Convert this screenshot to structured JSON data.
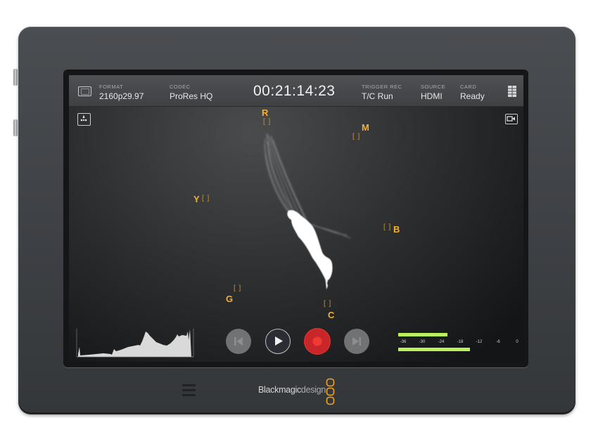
{
  "device": {
    "brand": "Blackmagic",
    "brand_suffix": "design",
    "accent_color": "#f2b134"
  },
  "status_bar": {
    "format": {
      "label": "FORMAT",
      "value": "2160p29.97"
    },
    "codec": {
      "label": "CODEC",
      "value": "ProRes HQ"
    },
    "timecode": "00:21:14:23",
    "trigger_rec": {
      "label": "TRIGGER REC",
      "value": "T/C Run"
    },
    "source": {
      "label": "SOURCE",
      "value": "HDMI"
    },
    "card": {
      "label": "CARD",
      "value": "Ready"
    }
  },
  "icons": {
    "display_mode": "display-icon",
    "settings_menu": "menu-grid-icon",
    "scope_toggle": "vectorscope-icon",
    "camera": "camera-icon"
  },
  "vectorscope": {
    "targets": [
      {
        "label": "R",
        "bracket": "[ ]"
      },
      {
        "label": "M",
        "bracket": "[ ]"
      },
      {
        "label": "Y",
        "bracket": "[ ]"
      },
      {
        "label": "B",
        "bracket": "[ ]"
      },
      {
        "label": "G",
        "bracket": "[ ]"
      },
      {
        "label": "C",
        "bracket": "[ ]"
      }
    ]
  },
  "transport": {
    "prev": "skip-back",
    "play": "play",
    "record": "record",
    "next": "skip-forward",
    "record_color": "#e0292b"
  },
  "audio_meter": {
    "scale": [
      "-36",
      "-30",
      "-24",
      "-18",
      "-12",
      "-6",
      "0"
    ],
    "channel_1_level_db": -22,
    "channel_2_level_db": -15,
    "meter_color": "#b9f25a"
  }
}
